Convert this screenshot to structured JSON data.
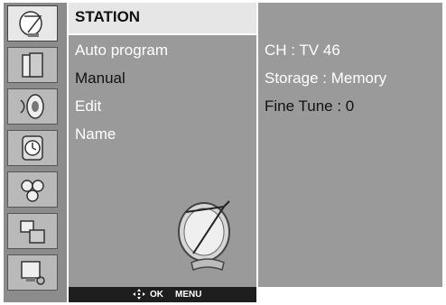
{
  "menu": {
    "title": "STATION",
    "items": [
      {
        "label": "Auto program",
        "state": "normal"
      },
      {
        "label": "Manual",
        "state": "selected"
      },
      {
        "label": "Edit",
        "state": "normal"
      },
      {
        "label": "Name",
        "state": "normal"
      }
    ]
  },
  "details": {
    "lines": [
      {
        "label": "CH : TV 46",
        "state": "normal"
      },
      {
        "label": "Storage : Memory",
        "state": "normal"
      },
      {
        "label": "Fine Tune : 0",
        "state": "selected"
      }
    ]
  },
  "side_icons": [
    {
      "name": "satellite-dish-icon",
      "selected": true
    },
    {
      "name": "picture-panel-icon",
      "selected": false
    },
    {
      "name": "speaker-audio-icon",
      "selected": false
    },
    {
      "name": "clock-time-icon",
      "selected": false
    },
    {
      "name": "gears-special-icon",
      "selected": false
    },
    {
      "name": "screen-adjust-icon",
      "selected": false
    },
    {
      "name": "lock-setup-icon",
      "selected": false
    }
  ],
  "footer": {
    "nav_icon": "four-way-arrow-icon",
    "ok_label": "OK",
    "menu_label": "MENU"
  },
  "colors": {
    "panel": "#9a9a9a",
    "title_bg": "#e6e6e6",
    "footer_bg": "#1e1e1e",
    "highlight_text": "#111111",
    "normal_text": "#ffffff"
  }
}
